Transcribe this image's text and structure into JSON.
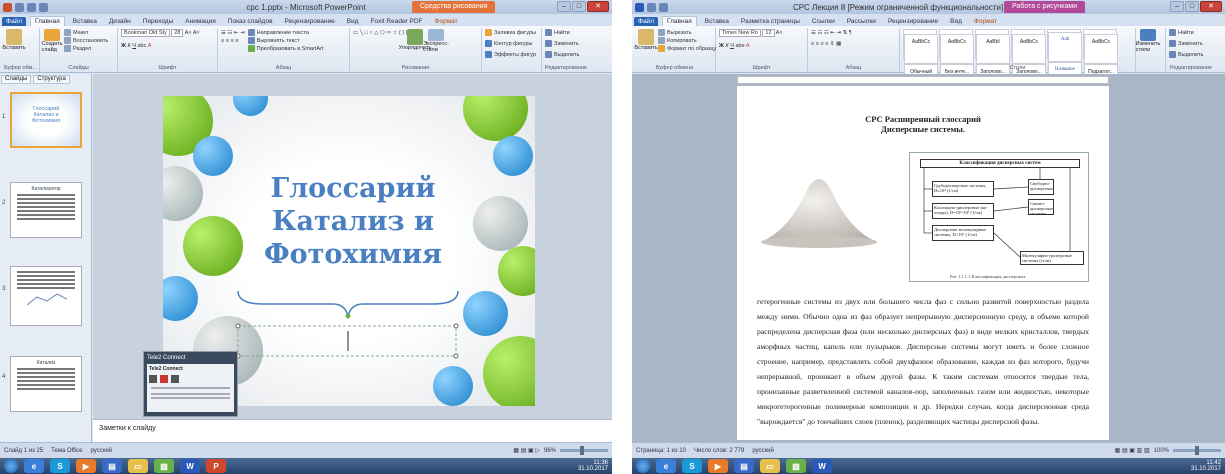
{
  "ppt": {
    "title": "срс 1.pptx - Microsoft PowerPoint",
    "context_tab": "Средства рисования",
    "tabs": [
      "Файл",
      "Главная",
      "Вставка",
      "Дизайн",
      "Переходы",
      "Анимация",
      "Показ слайдов",
      "Рецензирование",
      "Вид",
      "Foxit Reader PDF",
      "Формат"
    ],
    "ribbon": {
      "paste": "Вставить",
      "create_slide": "Создать слайд",
      "layout": "Макет",
      "reset": "Восстановить",
      "section": "Раздел",
      "font_name": "Bookman Old Sty",
      "font_size": "28",
      "text_dir": "Направление текста",
      "align_text": "Выровнять текст",
      "smartart": "Преобразовать в SmartArt",
      "arrange": "Упорядочить",
      "quick_styles": "Экспресс-стили",
      "shape_fill": "Заливка фигуры",
      "shape_outline": "Контур фигуры",
      "shape_effects": "Эффекты фигур",
      "find": "Найти",
      "replace": "Заменить",
      "select": "Выделить",
      "groups": [
        "Буфер обм...",
        "Слайды",
        "Шрифт",
        "Абзац",
        "Рисование",
        "Редактирование"
      ]
    },
    "panel_tabs": [
      "Слайды",
      "Структура"
    ],
    "thumbs": [
      {
        "num": "1",
        "title": "Глоссарий Катализ и Фотохимия"
      },
      {
        "num": "2",
        "title": "Катализатор"
      },
      {
        "num": "3",
        "title": ""
      },
      {
        "num": "4",
        "title": "Катализ"
      }
    ],
    "slide_title": [
      "Глоссарий",
      "Катализ и",
      "Фотохимия"
    ],
    "notes": "Заметки к слайду",
    "popup": {
      "title": "Tele2 Connect",
      "inner_title": "Tele2 Connect"
    },
    "status": {
      "slide": "Слайд 1 из 25",
      "theme": "Тема Office",
      "lang": "русский",
      "zoom": "96%"
    }
  },
  "word": {
    "title": "СРС Лекция 8 [Режим ограниченной функциональности] - Microsoft Word",
    "context_tab": "Работа с рисунками",
    "tabs": [
      "Файл",
      "Главная",
      "Вставка",
      "Разметка страницы",
      "Ссылки",
      "Рассылки",
      "Рецензирование",
      "Вид",
      "Формат"
    ],
    "ribbon": {
      "cut": "Вырезать",
      "copy": "Копировать",
      "format_painter": "Формат по образцу",
      "paste": "Вставить",
      "font_name": "Times New Ro",
      "font_size": "12",
      "styles": [
        "AaBbCc",
        "AaBbCc",
        "AaBbI",
        "AaBbCc",
        "Aab",
        "AaBbCc"
      ],
      "style_names": [
        "Обычный",
        "Без инте...",
        "Заголово...",
        "Заголово...",
        "Название",
        "Подзагол..."
      ],
      "change_styles": "Изменить стили",
      "find": "Найти",
      "replace": "Заменить",
      "select": "Выделить",
      "groups": [
        "Буфер обмена",
        "Шрифт",
        "Абзац",
        "Стили",
        "Редактирование"
      ]
    },
    "doc": {
      "h1": "СРС   Расширенный глоссарий",
      "h2": "Дисперсные системы.",
      "diagram_title": "Классификация дисперсных систем",
      "diagram_boxes": [
        "Грубодисперсные системы, D≤10⁴ (1/см)",
        "Коллоидно-дисперсные (ко­лоиды), D=10⁵-10⁷ (1/см)",
        "Дисперсные молекулярные системы, D>10⁷ (1/см)",
        "Свободно-дисперсные",
        "Связно-дисперсные системы",
        "Молекулярно-дисперсные системы (гели)"
      ],
      "caption": "Рис 1.1.1.1 Классификация дисперсных",
      "paragraph": "гетерогенные системы из двух или большего числа фаз с сильно развитой поверхностью раздела между ними. Обычно одна из фаз образует непрерывную дисперсионную среду, в объеме которой распределена дисперсная фаза (или несколько дисперсных фаз) в виде мелких кристаллов, твердых аморфных частиц, капель или пузырьков. Дисперсные системы могут иметь и более сложное строение, например, представлять собой двухфазное образование, каждая из фаз которого, будучи непрерывной, проникает в объем другой фазы. К таким системам относятся твердые тела, пронизанные разветвленной системой каналов-пор, заполненных газом или жидкостью, некоторые микрогетерогенные полимерные композиции и др. Нередки случаи, когда дисперсионная среда \"вырождается\" до тончайших слоев (пленок), разделяющих частицы дисперсной фазы."
    },
    "status": {
      "page": "Страница: 1 из 10",
      "words": "Число слов: 2 779",
      "lang": "русский",
      "zoom": "100%"
    }
  },
  "clock": {
    "time": "11:36",
    "date": "31.10.2017",
    "time2": "11:42"
  },
  "colors": {
    "accent": "#2a62b8",
    "slide_title": "#4a7fc2",
    "bubble_green": "#7cc424",
    "bubble_blue": "#2f9fe0"
  }
}
